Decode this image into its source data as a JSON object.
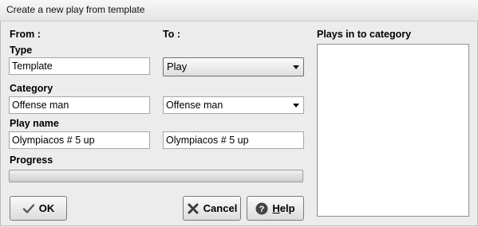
{
  "window": {
    "title": "Create a new play from template"
  },
  "from": {
    "header": "From :",
    "type_label": "Type",
    "type_value": "Template",
    "category_label": "Category",
    "category_value": "Offense man",
    "playname_label": "Play name",
    "playname_value": "Olympiacos # 5 up"
  },
  "to": {
    "header": "To :",
    "type_value": "Play",
    "category_value": "Offense man",
    "playname_value": "Olympiacos # 5 up"
  },
  "progress": {
    "label": "Progress",
    "value": 0
  },
  "plays_list": {
    "header": "Plays in to category",
    "items": []
  },
  "buttons": {
    "ok": "OK",
    "cancel": "Cancel",
    "help_first": "H",
    "help_rest": "elp"
  },
  "icons": {
    "ok": "checkmark-icon",
    "cancel": "x-icon",
    "help": "question-icon"
  },
  "colors": {
    "checkmark": "#5a5a5a",
    "cancel_x": "#3c3c3c",
    "help_circle": "#444444"
  }
}
